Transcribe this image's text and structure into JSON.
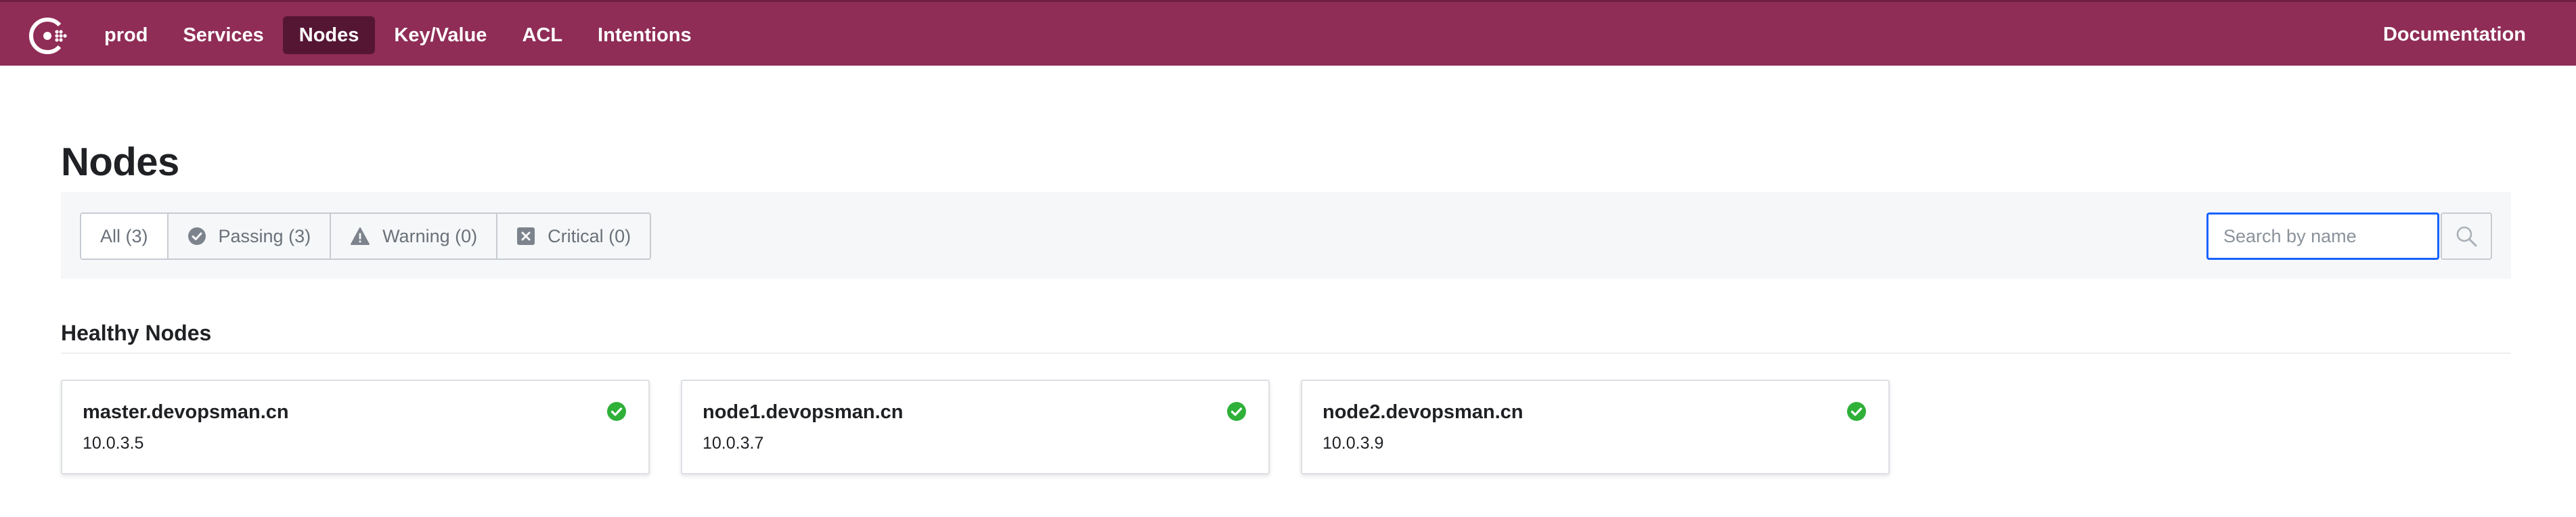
{
  "nav": {
    "datacenter": "prod",
    "items": [
      {
        "label": "Services",
        "active": false
      },
      {
        "label": "Nodes",
        "active": true
      },
      {
        "label": "Key/Value",
        "active": false
      },
      {
        "label": "ACL",
        "active": false
      },
      {
        "label": "Intentions",
        "active": false
      }
    ],
    "documentation": "Documentation"
  },
  "page": {
    "title": "Nodes"
  },
  "filters": [
    {
      "label": "All (3)",
      "icon": "none",
      "active": true
    },
    {
      "label": "Passing (3)",
      "icon": "passing-icon",
      "active": false
    },
    {
      "label": "Warning (0)",
      "icon": "warning-icon",
      "active": false
    },
    {
      "label": "Critical (0)",
      "icon": "critical-icon",
      "active": false
    }
  ],
  "search": {
    "placeholder": "Search by name",
    "value": ""
  },
  "section": {
    "title": "Healthy Nodes"
  },
  "nodes": [
    {
      "name": "master.devopsman.cn",
      "address": "10.0.3.5",
      "status": "passing"
    },
    {
      "name": "node1.devopsman.cn",
      "address": "10.0.3.7",
      "status": "passing"
    },
    {
      "name": "node2.devopsman.cn",
      "address": "10.0.3.9",
      "status": "passing"
    }
  ],
  "colors": {
    "brand": "#8f2d56",
    "nav_active": "#551634",
    "passing": "#2eb039",
    "focus": "#1563ff"
  }
}
